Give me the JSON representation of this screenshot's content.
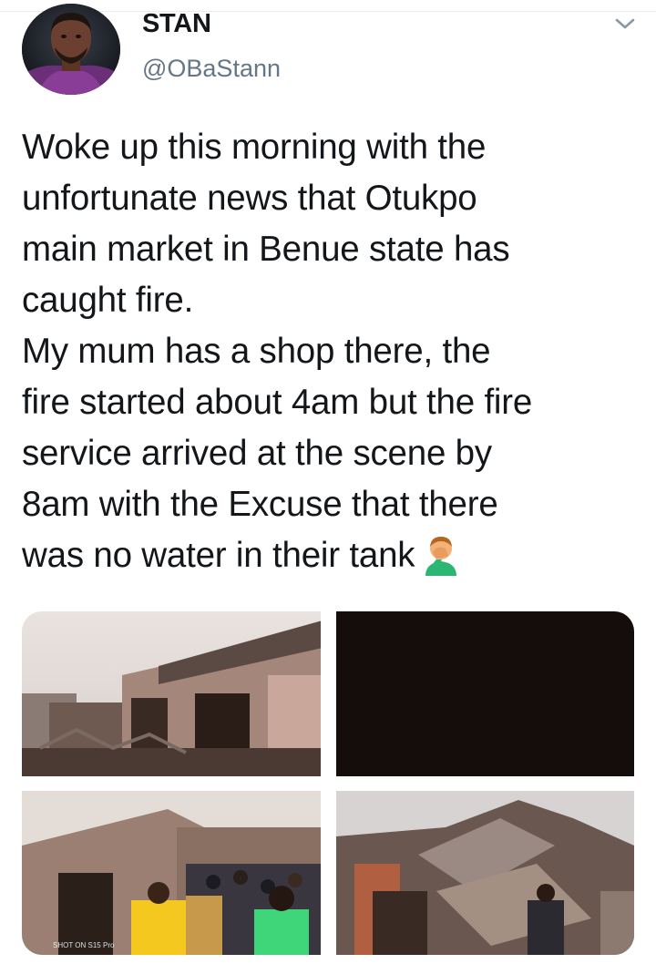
{
  "author": {
    "name": "STAN",
    "handle": "@OBaStann"
  },
  "tweet": {
    "text": "Woke up this morning with the\nunfortunate news that Otukpo\nmain market in Benue state has\ncaught fire.\nMy mum has a shop there, the\nfire started about 4am but the fire\nservice arrived at the scene by\n8am with the Excuse that there\nwas no water in their tank",
    "emoji": "man-facepalming"
  },
  "media": {
    "watermark": "SHOT ON S15 Pro"
  },
  "icons": {
    "chevron": "chevron-down-icon"
  },
  "colors": {
    "text": "#14171a",
    "secondary": "#657786",
    "divider": "#e6ecf0"
  }
}
